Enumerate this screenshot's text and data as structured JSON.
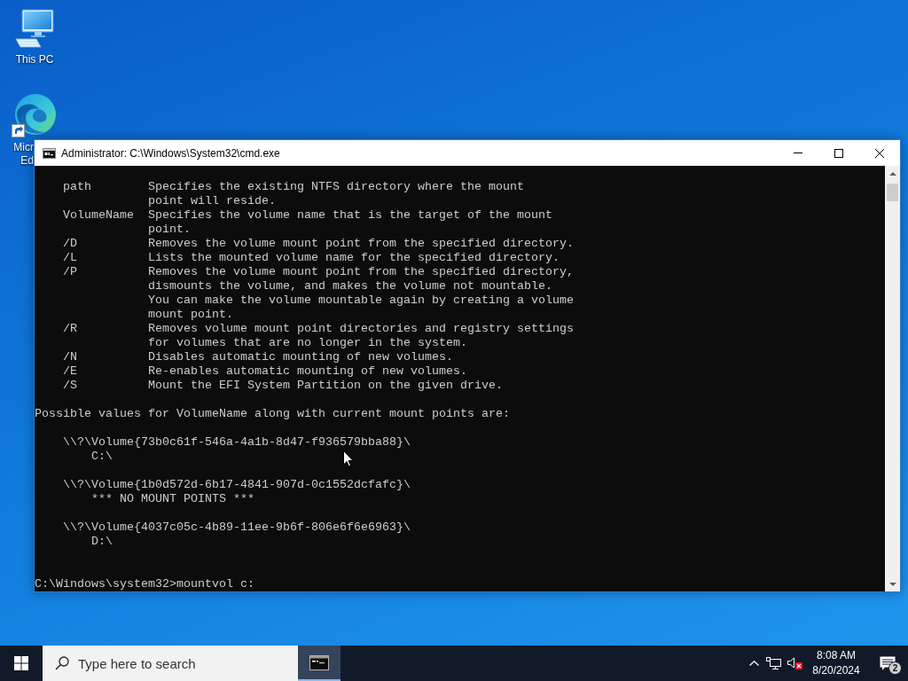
{
  "desktop_icons": [
    {
      "kind": "computer",
      "label_lines": [
        "This PC"
      ]
    },
    {
      "kind": "browser",
      "label_lines": [
        "Micr",
        "Ed"
      ]
    }
  ],
  "window": {
    "title": "Administrator: C:\\Windows\\System32\\cmd.exe",
    "console": {
      "parameters": [
        {
          "name": "path",
          "lines": [
            "Specifies the existing NTFS directory where the mount",
            "point will reside."
          ]
        },
        {
          "name": "VolumeName",
          "lines": [
            "Specifies the volume name that is the target of the mount",
            "point."
          ]
        },
        {
          "name": "/D",
          "lines": [
            "Removes the volume mount point from the specified directory."
          ]
        },
        {
          "name": "/L",
          "lines": [
            "Lists the mounted volume name for the specified directory."
          ]
        },
        {
          "name": "/P",
          "lines": [
            "Removes the volume mount point from the specified directory,",
            "dismounts the volume, and makes the volume not mountable.",
            "You can make the volume mountable again by creating a volume",
            "mount point."
          ]
        },
        {
          "name": "/R",
          "lines": [
            "Removes volume mount point directories and registry settings",
            "for volumes that are no longer in the system."
          ]
        },
        {
          "name": "/N",
          "lines": [
            "Disables automatic mounting of new volumes."
          ]
        },
        {
          "name": "/E",
          "lines": [
            "Re-enables automatic mounting of new volumes."
          ]
        },
        {
          "name": "/S",
          "lines": [
            "Mount the EFI System Partition on the given drive."
          ]
        }
      ],
      "volumes_heading": "Possible values for VolumeName along with current mount points are:",
      "volumes": [
        {
          "path": "\\\\?\\Volume{73b0c61f-546a-4a1b-8d47-f936579bba88}\\",
          "mount": "C:\\"
        },
        {
          "path": "\\\\?\\Volume{1b0d572d-6b17-4841-907d-0c1552dcfafc}\\",
          "mount": "*** NO MOUNT POINTS ***"
        },
        {
          "path": "\\\\?\\Volume{4037c05c-4b89-11ee-9b6f-806e6f6e6963}\\",
          "mount": "D:\\"
        }
      ],
      "prompt_line": "C:\\Windows\\system32>mountvol c:"
    }
  },
  "taskbar": {
    "search": {
      "placeholder": "Type here to search"
    },
    "apps": [
      {
        "kind": "terminal",
        "selected": true
      }
    ],
    "tray": {
      "volume_muted": true,
      "time": "8:08 AM",
      "date": "8/20/2024",
      "notifications": "2"
    }
  }
}
